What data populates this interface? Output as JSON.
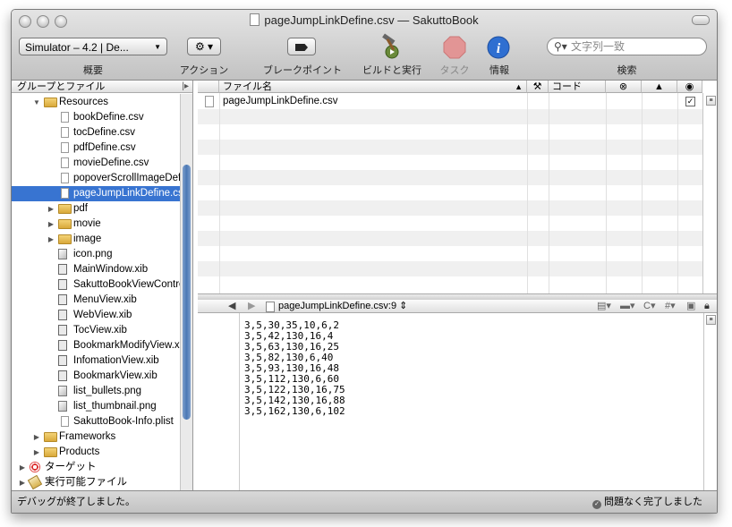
{
  "window": {
    "title": "pageJumpLinkDefine.csv — SakuttoBook"
  },
  "toolbar": {
    "scheme_popup": "Simulator – 4.2 | De...",
    "overview_label": "概要",
    "action_label": "アクション",
    "breakpoints_label": "ブレークポイント",
    "build_run_label": "ビルドと実行",
    "tasks_label": "タスク",
    "info_label": "情報",
    "search_placeholder": "文字列一致",
    "search_label": "検索"
  },
  "sidebar": {
    "header": "グループとファイル",
    "items": [
      {
        "label": "Resources",
        "kind": "folder",
        "indent": 1,
        "disclosure": "open"
      },
      {
        "label": "bookDefine.csv",
        "kind": "file",
        "indent": 2
      },
      {
        "label": "tocDefine.csv",
        "kind": "file",
        "indent": 2
      },
      {
        "label": "pdfDefine.csv",
        "kind": "file",
        "indent": 2
      },
      {
        "label": "movieDefine.csv",
        "kind": "file",
        "indent": 2
      },
      {
        "label": "popoverScrollImageDefine.csv",
        "kind": "file",
        "indent": 2
      },
      {
        "label": "pageJumpLinkDefine.csv",
        "kind": "file",
        "indent": 2,
        "selected": true
      },
      {
        "label": "pdf",
        "kind": "folder",
        "indent": 2,
        "disclosure": "closed"
      },
      {
        "label": "movie",
        "kind": "folder",
        "indent": 2,
        "disclosure": "closed"
      },
      {
        "label": "image",
        "kind": "folder",
        "indent": 2,
        "disclosure": "closed"
      },
      {
        "label": "icon.png",
        "kind": "png",
        "indent": 2
      },
      {
        "label": "MainWindow.xib",
        "kind": "xib",
        "indent": 2
      },
      {
        "label": "SakuttoBookViewController.xib",
        "kind": "xib",
        "indent": 2
      },
      {
        "label": "MenuView.xib",
        "kind": "xib",
        "indent": 2
      },
      {
        "label": "WebView.xib",
        "kind": "xib",
        "indent": 2
      },
      {
        "label": "TocView.xib",
        "kind": "xib",
        "indent": 2
      },
      {
        "label": "BookmarkModifyView.xib",
        "kind": "xib",
        "indent": 2
      },
      {
        "label": "InfomationView.xib",
        "kind": "xib",
        "indent": 2
      },
      {
        "label": "BookmarkView.xib",
        "kind": "xib",
        "indent": 2
      },
      {
        "label": "list_bullets.png",
        "kind": "png",
        "indent": 2
      },
      {
        "label": "list_thumbnail.png",
        "kind": "png",
        "indent": 2
      },
      {
        "label": "SakuttoBook-Info.plist",
        "kind": "file",
        "indent": 2
      },
      {
        "label": "Frameworks",
        "kind": "folder",
        "indent": 1,
        "disclosure": "closed"
      },
      {
        "label": "Products",
        "kind": "folder",
        "indent": 1,
        "disclosure": "closed"
      },
      {
        "label": "ターゲット",
        "kind": "target",
        "indent": 0,
        "disclosure": "closed"
      },
      {
        "label": "実行可能ファイル",
        "kind": "exec",
        "indent": 0,
        "disclosure": "closed"
      }
    ]
  },
  "filelist": {
    "col_filename": "ファイル名",
    "col_code": "コード",
    "rows": [
      {
        "name": "pageJumpLinkDefine.csv",
        "checked": true
      }
    ]
  },
  "editor": {
    "nav_file": "pageJumpLinkDefine.csv:9",
    "lines": [
      "3,5,30,35,10,6,2",
      "3,5,42,130,16,4",
      "3,5,63,130,16,25",
      "3,5,82,130,6,40",
      "3,5,93,130,16,48",
      "3,5,112,130,6,60",
      "3,5,122,130,16,75",
      "3,5,142,130,16,88",
      "3,5,162,130,6,102"
    ]
  },
  "status": {
    "left": "デバッグが終了しました。",
    "right": "問題なく完了しました"
  }
}
